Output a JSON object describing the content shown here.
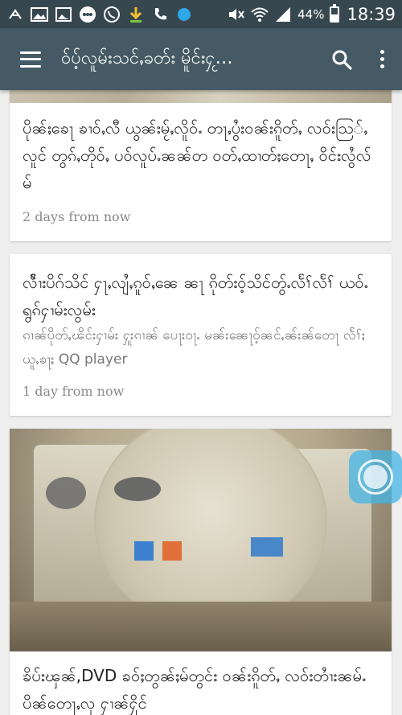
{
  "status_bar": {
    "battery_text": "44%",
    "battery_level": 0.44,
    "time": "18:39",
    "icons": [
      "app-notification-icon",
      "gallery-icon",
      "image-icon",
      "messenger-icon",
      "viber-icon",
      "download-icon",
      "call-icon",
      "blue-dot-icon",
      "mute-icon",
      "wifi-icon",
      "signal-icon"
    ]
  },
  "app_bar": {
    "title": "ဝ်ပ့်လူမ်းသင်ႇခတ်း မိူင်းႁႂ…",
    "menu_icon": "menu-icon",
    "search_icon": "search-icon",
    "overflow_icon": "more-vert-icon"
  },
  "feed": {
    "cards": [
      {
        "title": "ပိုၼ်ႈၶေႃ ၶၢဝ်ႇလီ ယွၼ်းမႂ်ႇလိူဝ်ႉ တႃႇပွႆးဝၼ်းၵိူတ်ႇ လဝ်းသြ်ႇလူင် တွၵ်ႇတိုဝ်ႇ ပဝ်လူပ်ႉၼၼ်တ ဝတ်ႇထၢတ်ႈတေႃႇ ဝိင်းလွႆလ်မ်",
        "time": "2 days from now"
      },
      {
        "title": "လႅၢႆးပိဂ်သိင် ႁႃႇလျႆႇၵူဝ်ႇၼေ ၼႃ ၵိုတ်းဝ့်သိင်တွ်ႉလႅၢ်လႅၢ် ယဝ်ႉရွၵ်ႁၢမ်းလွမ်း",
        "excerpt": "ၵၢၼ်ပိုတ်ႇၽိင်းႁၢမ်း ႁူးၵၢၼ် ပေႃးဝႃႉ မၼ်းၼေႃဝ့်ၼင်ႇၼ်းၼ်တေႃ လႅၢ်ႈယူႇၶႃႈ QQ player",
        "time": "1 day from now"
      },
      {
        "title": "ၶိပ်းၾၼ်,DVD ၶဝ်ႈတွၼ်ႈမ်တွင်း ဝၼ်းၵိူတ်ႇ လဝ်းတၢႆးၼမ်ႉ ပိၼ်တေႃႇလု ႁၢၼ်ႁိုင်"
      }
    ]
  },
  "floating_button": {
    "icon": "assistive-touch-icon"
  },
  "colors": {
    "status_bar": "#37474f",
    "app_bar": "#455a64",
    "background": "#eeeeee",
    "card": "#ffffff",
    "title_text": "#222222",
    "excerpt_text": "#777777",
    "time_text": "#8a8a8a",
    "floating_button": "#44b4e6"
  }
}
